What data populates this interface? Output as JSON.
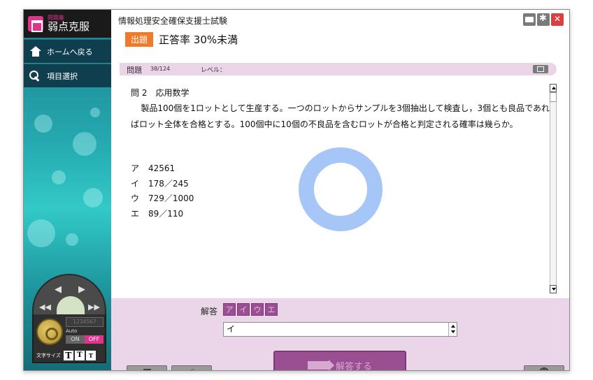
{
  "app": {
    "logo_sub": "問題集",
    "logo_main": "弱点克服",
    "title": "情報処理安全確保支援士試験"
  },
  "sidebar": {
    "nav": [
      {
        "label": "ホームへ戻る",
        "icon": "home-icon"
      },
      {
        "label": "項目選択",
        "icon": "search-icon"
      }
    ],
    "player": {
      "digits": "1234567",
      "auto_label": "Auto",
      "on_label": "ON",
      "off_label": "OFF",
      "off_active": true
    },
    "font_size": {
      "label": "文字サイズ",
      "buttons": [
        "T",
        "T",
        "T"
      ]
    }
  },
  "header": {
    "badge": "出題",
    "subtitle": "正答率 30%未満"
  },
  "info": {
    "question_label": "問題",
    "question_num": "38/124",
    "level_label": "レベル："
  },
  "question": {
    "heading": "問 2　応用数学",
    "body": "製品100個を1ロットとして生産する。一つのロットからサンプルを3個抽出して検査し，3個とも良品であればロット全体を合格とする。100個中に10個の不良品を含むロットが合格と判定される確率は幾らか。",
    "choices": [
      {
        "key": "ア",
        "text": "42561"
      },
      {
        "key": "イ",
        "text": "178／245"
      },
      {
        "key": "ウ",
        "text": "729／1000"
      },
      {
        "key": "エ",
        "text": "89／110"
      }
    ]
  },
  "answer": {
    "label": "解答",
    "options": [
      "ア",
      "イ",
      "ウ",
      "エ"
    ],
    "value": "イ",
    "submit_label": "解答する"
  },
  "colors": {
    "accent": "#9b4f93",
    "badge": "#f07a2a",
    "off": "#e0338e",
    "spinner": "#a7c6f8"
  }
}
